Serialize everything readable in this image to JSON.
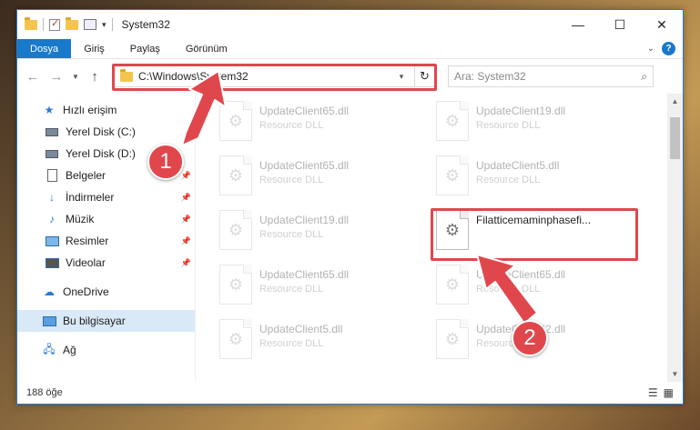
{
  "window": {
    "title": "System32"
  },
  "ribbon": {
    "tabs": [
      "Dosya",
      "Giriş",
      "Paylaş",
      "Görünüm"
    ],
    "active_tab": "Dosya",
    "help": "?"
  },
  "navbar": {
    "address": "C:\\Windows\\System32",
    "search_placeholder": "Ara: System32"
  },
  "sidebar": {
    "quick_access": "Hızlı erişim",
    "items": [
      {
        "label": "Yerel Disk (C:)",
        "icon": "disk-icon",
        "pinned": false
      },
      {
        "label": "Yerel Disk (D:)",
        "icon": "disk-icon",
        "pinned": false
      },
      {
        "label": "Belgeler",
        "icon": "document-icon",
        "pinned": true
      },
      {
        "label": "İndirmeler",
        "icon": "download-icon",
        "pinned": true
      },
      {
        "label": "Müzik",
        "icon": "music-icon",
        "pinned": true
      },
      {
        "label": "Resimler",
        "icon": "pictures-icon",
        "pinned": true
      },
      {
        "label": "Videolar",
        "icon": "videos-icon",
        "pinned": true
      }
    ],
    "onedrive": "OneDrive",
    "this_pc": "Bu bilgisayar",
    "network": "Ağ"
  },
  "files": [
    {
      "name": "UpdateClient65.dll",
      "type": "Resource DLL",
      "faded": true
    },
    {
      "name": "UpdateClient19.dll",
      "type": "Resource DLL",
      "faded": true
    },
    {
      "name": "UpdateClient65.dll",
      "type": "Resource DLL",
      "faded": true
    },
    {
      "name": "UpdateClient5.dll",
      "type": "Resource DLL",
      "faded": true
    },
    {
      "name": "UpdateClient19.dll",
      "type": "Resource DLL",
      "faded": true
    },
    {
      "name": "Filatticemaminphasefi...",
      "type": "",
      "faded": false
    },
    {
      "name": "UpdateClient65.dll",
      "type": "Resource DLL",
      "faded": true
    },
    {
      "name": "UpdateClient65.dll",
      "type": "Resource DLL",
      "faded": true
    },
    {
      "name": "UpdateClient5.dll",
      "type": "Resource DLL",
      "faded": true
    },
    {
      "name": "UpdateClient42.dll",
      "type": "Resource DLL",
      "faded": true
    }
  ],
  "status": {
    "count": "188 öğe"
  },
  "callouts": {
    "one": "1",
    "two": "2",
    "color": "#e0474c"
  }
}
